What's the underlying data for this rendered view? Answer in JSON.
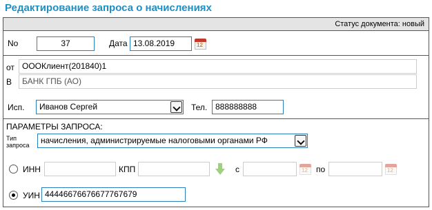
{
  "header": {
    "title": "Редактирование запроса о начислениях"
  },
  "status": {
    "text": "Статус документа: новый"
  },
  "doc": {
    "number_label": "No",
    "number_value": "37",
    "date_label": "Дата",
    "date_value": "13.08.2019",
    "calendar_day": "12"
  },
  "parties": {
    "from_label": "от",
    "from_value": "ОООКлиент(201840)1",
    "bank_label": "В",
    "bank_value": "БАНК ГПБ (АО)"
  },
  "executor": {
    "label": "Исп.",
    "value": "Иванов Сергей",
    "phone_label": "Тел.",
    "phone_value": "888888888"
  },
  "params": {
    "section_label": "ПАРАМЕТРЫ ЗАПРОСА:",
    "type_label_line1": "Тип",
    "type_label_line2": "запроса",
    "type_value": "начисления, администрируемые налоговыми органами РФ"
  },
  "inn_row": {
    "inn_label": "ИНН",
    "inn_value": "",
    "kpp_label": "КПП",
    "kpp_value": "",
    "from_label": "с",
    "from_value": "",
    "to_label": "по",
    "to_value": "",
    "selected": false
  },
  "uin_row": {
    "uin_label": "УИН",
    "uin_value": "44446676676677767679",
    "selected": true
  }
}
